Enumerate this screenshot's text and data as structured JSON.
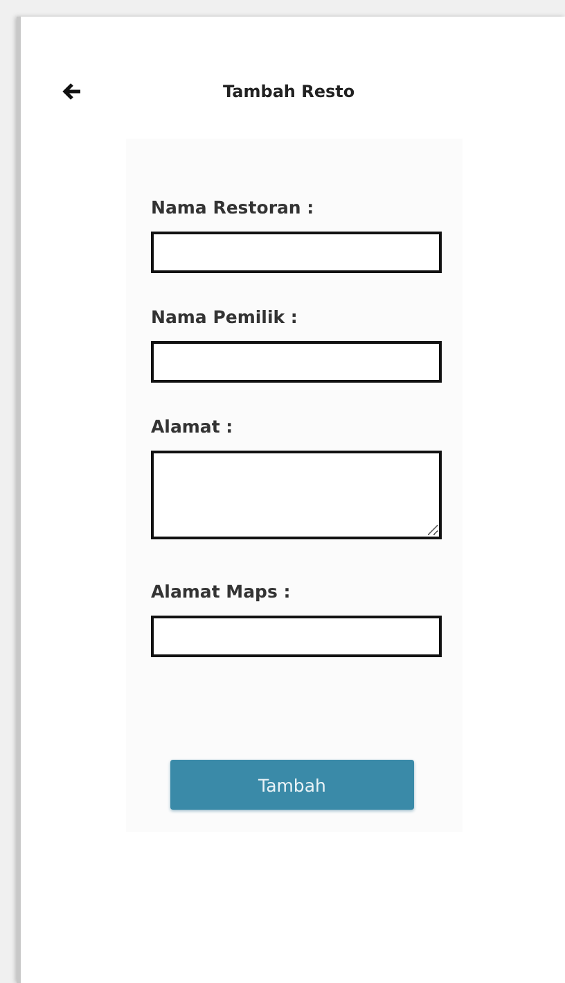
{
  "header": {
    "title": "Tambah Resto"
  },
  "fields": [
    {
      "label": "Nama Restoran :",
      "kind": "input"
    },
    {
      "label": "Nama Pemilik :",
      "kind": "input"
    },
    {
      "label": "Alamat :",
      "kind": "textarea"
    },
    {
      "label": "Alamat Maps :",
      "kind": "input"
    }
  ],
  "submit": {
    "label": "Tambah"
  }
}
